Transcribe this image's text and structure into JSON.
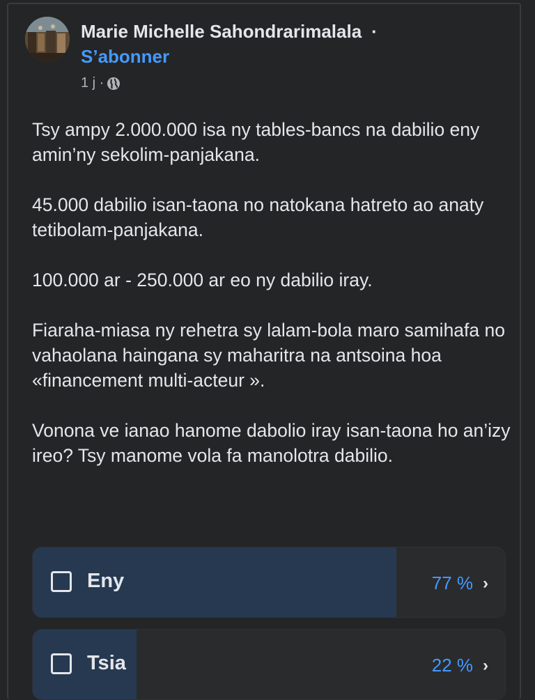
{
  "post": {
    "author": "Marie Michelle Sahondrarimalala",
    "separator": "·",
    "follow_label": "S’abonner",
    "time": "1 j ·",
    "audience_icon": "globe-icon",
    "paragraphs": [
      "Tsy ampy 2.000.000 isa ny tables-bancs na dabilio eny amin’ny sekolim-panjakana.",
      "45.000 dabilio isan-taona no natokana hatreto ao anaty tetibolam-panjakana.",
      "100.000 ar - 250.000 ar eo ny dabilio iray.",
      "Fiaraha-miasa ny rehetra sy lalam-bola maro samihafa no vahaolana haingana sy maharitra na antsoina hoa «financement multi-acteur ».",
      "Vonona ve ianao hanome dabolio iray isan-taona ho an’izy ireo? Tsy manome vola fa manolotra dabilio."
    ]
  },
  "poll": {
    "options": [
      {
        "label": "Eny",
        "percent_text": "77 %",
        "percent": 77,
        "chevron": "›"
      },
      {
        "label": "Tsia",
        "percent_text": "22 %",
        "percent": 22,
        "chevron": "›"
      }
    ]
  },
  "colors": {
    "background": "#242526",
    "link": "#4599ff",
    "poll_fill": "#263951"
  }
}
